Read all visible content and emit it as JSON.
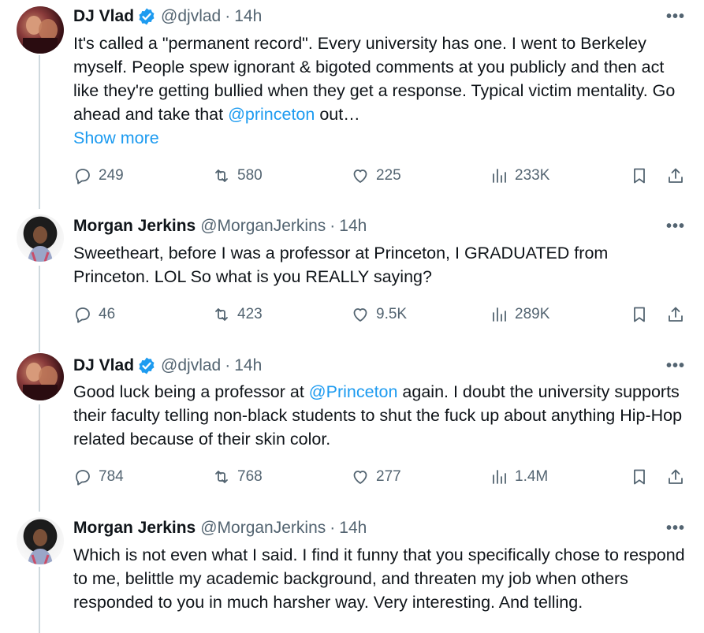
{
  "tweets": [
    {
      "name": "DJ Vlad",
      "verified": true,
      "handle": "@djvlad",
      "time": "14h",
      "text_parts": [
        "It's called a \"permanent record\".  Every university has one.  I went to Berkeley myself.   People spew ignorant & bigoted comments at you publicly and then act like they're getting bullied when they get a response.  Typical victim mentality.  Go ahead and take that ",
        "@princeton",
        " out…"
      ],
      "show_more": "Show more",
      "stats": {
        "replies": "249",
        "retweets": "580",
        "likes": "225",
        "views": "233K"
      }
    },
    {
      "name": "Morgan Jerkins",
      "verified": false,
      "handle": "@MorganJerkins",
      "time": "14h",
      "text_parts": [
        "Sweetheart, before I was a professor at Princeton, I GRADUATED from Princeton. LOL So what is you REALLY saying?"
      ],
      "stats": {
        "replies": "46",
        "retweets": "423",
        "likes": "9.5K",
        "views": "289K"
      }
    },
    {
      "name": "DJ Vlad",
      "verified": true,
      "handle": "@djvlad",
      "time": "14h",
      "text_parts": [
        "Good luck being a professor at ",
        "@Princeton",
        " again.  I doubt the university supports their faculty telling non-black students to shut the fuck up about anything Hip-Hop related because of their skin color."
      ],
      "stats": {
        "replies": "784",
        "retweets": "768",
        "likes": "277",
        "views": "1.4M"
      }
    },
    {
      "name": "Morgan Jerkins",
      "verified": false,
      "handle": "@MorganJerkins",
      "time": "14h",
      "text_parts": [
        "Which is not even what I said. I find it funny that you specifically chose to respond to me, belittle my academic background, and threaten my job when others responded to you in much harsher way. Very interesting. And telling."
      ]
    }
  ],
  "ui": {
    "dot": "·",
    "more": "•••"
  },
  "colors": {
    "link": "#1d9bf0",
    "muted": "#536471",
    "text": "#0f1419",
    "thread_line": "#cfd9de"
  },
  "icons": [
    "reply-icon",
    "retweet-icon",
    "like-icon",
    "views-icon",
    "bookmark-icon",
    "share-icon",
    "verified-badge-icon",
    "more-icon"
  ]
}
